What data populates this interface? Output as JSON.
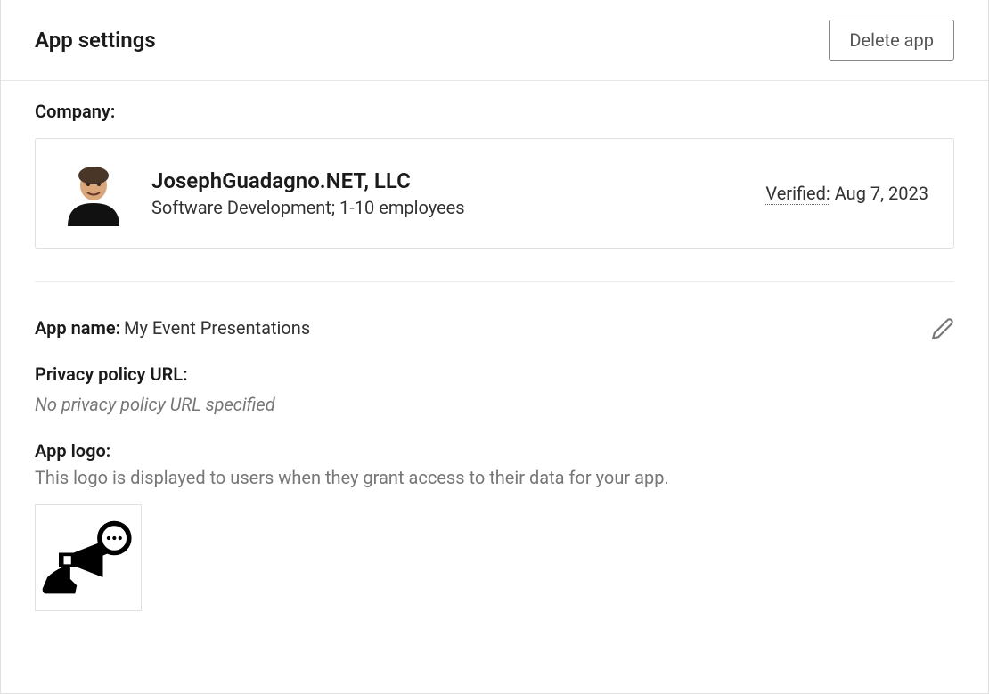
{
  "header": {
    "title": "App settings",
    "delete_label": "Delete app"
  },
  "company": {
    "section_label": "Company:",
    "name": "JosephGuadagno.NET, LLC",
    "description": "Software Development; 1-10 employees",
    "verified_label": "Verified:",
    "verified_date": "Aug 7, 2023"
  },
  "app": {
    "name_label": "App name:",
    "name_value": "My Event Presentations",
    "privacy_label": "Privacy policy URL:",
    "privacy_empty": "No privacy policy URL specified",
    "logo_label": "App logo:",
    "logo_desc": "This logo is displayed to users when they grant access to their data for your app."
  }
}
